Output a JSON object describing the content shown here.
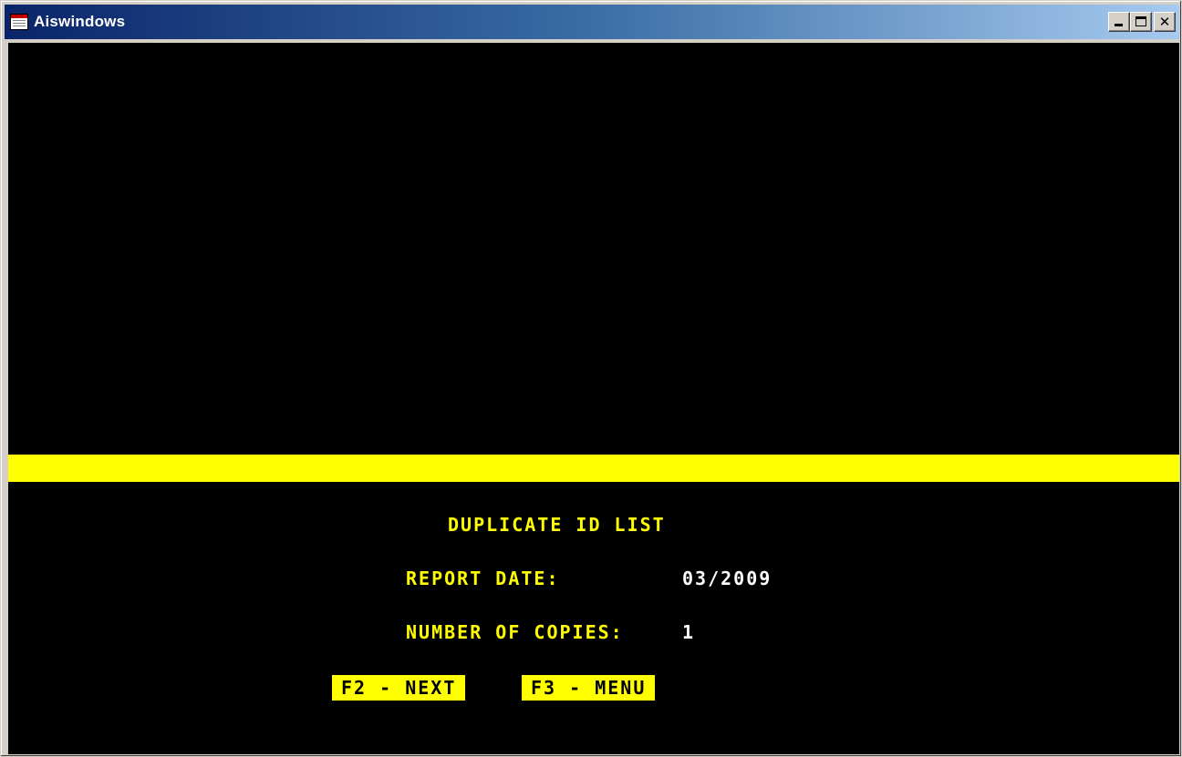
{
  "window": {
    "title": "Aiswindows",
    "icon": "app-window-icon",
    "controls": {
      "minimize": "minimize-icon",
      "maximize": "maximize-icon",
      "close": "✕"
    }
  },
  "colors": {
    "background": "#000000",
    "accent": "#ffff00",
    "value_text": "#ffffff",
    "titlebar_start": "#0a246a",
    "titlebar_end": "#a6caf0"
  },
  "screen": {
    "heading": "DUPLICATE ID LIST",
    "report_date_label": "REPORT DATE:",
    "report_date_value": "03/2009",
    "copies_label": "NUMBER OF COPIES:",
    "copies_value": "1",
    "function_keys": {
      "next": "F2 - NEXT",
      "menu": "F3 - MENU"
    }
  }
}
